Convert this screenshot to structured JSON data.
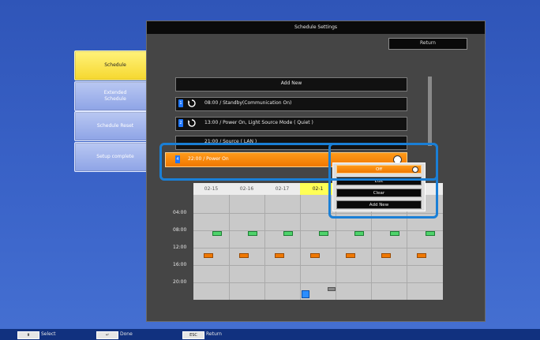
{
  "window": {
    "title": "Schedule Settings"
  },
  "sidebar": {
    "items": [
      {
        "label": "Schedule"
      },
      {
        "label": "Extended\nSchedule"
      },
      {
        "label": "Schedule Reset"
      },
      {
        "label": "Setup complete"
      }
    ]
  },
  "header": {
    "return_label": "Return"
  },
  "list": {
    "add_new_label": "Add New",
    "rows": [
      {
        "text": "08:00 / Standby(Communication On)"
      },
      {
        "text": "13:00 / Power On, Light Source Mode ( Quiet )"
      },
      {
        "text": "21:00 / Source ( LAN )"
      }
    ],
    "selected": {
      "index_label": "4",
      "text": "22:00 / Power On"
    }
  },
  "popup": {
    "items": [
      {
        "label": "Off"
      },
      {
        "label": "Edit"
      },
      {
        "label": "Clear"
      },
      {
        "label": "Add New"
      }
    ]
  },
  "calendar": {
    "dates": [
      "02-15",
      "02-16",
      "02-17",
      "02-1"
    ],
    "times": [
      "04:00",
      "08:00",
      "12:00",
      "16:00",
      "20:00"
    ]
  },
  "bottom_bar": {
    "select_label": "Select",
    "done_label": "Done",
    "return_label": "Return",
    "esc_key": "ESC"
  },
  "colors": {
    "accent_orange": "#f07800",
    "highlight_blue": "#1a7fd6",
    "today_yellow": "#ffff55",
    "event_green": "#4fd36b"
  }
}
